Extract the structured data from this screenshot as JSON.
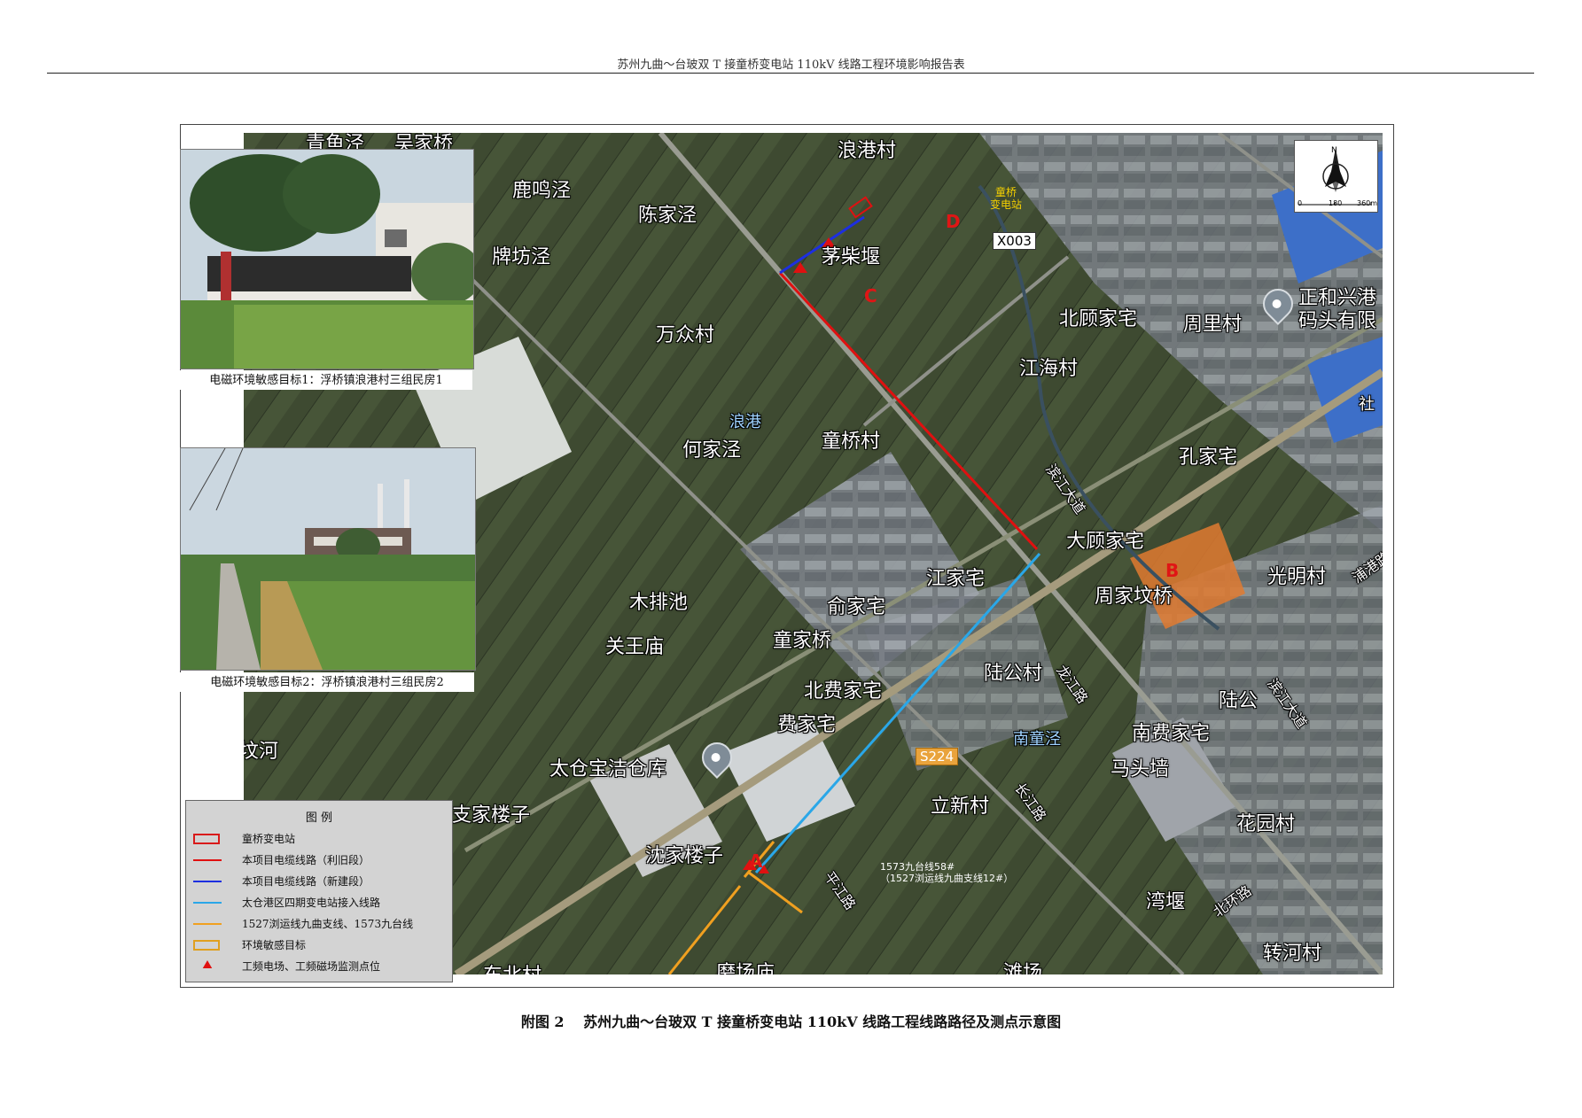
{
  "header": {
    "title": "苏州九曲～台玻双 T 接童桥变电站 110kV 线路工程环境影响报告表"
  },
  "map": {
    "places": {
      "qingyujing": "青鱼泾",
      "wujiaqiao": "吴家桥",
      "jiazhai": "家宅",
      "lumingjing": "鹿鸣泾",
      "langgangcun": "浪港村",
      "chenjiajing": "陈家泾",
      "paifangjing": "牌坊泾",
      "maochaiyan": "茅柴堰",
      "wanzhongcun": "万众村",
      "beigujiazhai": "北顾家宅",
      "zhoulicun": "周里村",
      "jianghaicun": "江海村",
      "langgang": "浪港",
      "hejiajing": "何家泾",
      "tongqiaocun": "童桥村",
      "kongjiazhai": "孔家宅",
      "dagujiazhai": "大顾家宅",
      "guangmingcun": "光明村",
      "zhoujiafenqiao": "周家坟桥",
      "jiangjiazhai": "江家宅",
      "mupaichi": "木排池",
      "yujiazhai": "俞家宅",
      "guanwangmiao": "关王庙",
      "tongjiaqiao": "童家桥",
      "lugongcun": "陆公村",
      "lugong": "陆公",
      "beifeijiazhai": "北费家宅",
      "feijiazhai": "费家宅",
      "nantongjing": "南童泾",
      "nanfeijiazhai": "南费家宅",
      "fenhe": "坟河",
      "taicangwarehouse": "太仓宝洁仓库",
      "matouqiang": "马头墙",
      "lixincun": "立新村",
      "zhijialouzi": "支家楼子",
      "huayuancun": "花园村",
      "shenjialouzi": "沈家楼子",
      "wanyan": "湾堰",
      "zhuanhecun": "转河村",
      "dongbeicun": "东北村",
      "mochangmiao": "磨场庙",
      "tanchang": "滩场",
      "zhenghexing": "正和兴港",
      "matouyouxian": "码头有限",
      "she": "社",
      "jiaqiao": "家桥"
    },
    "roads": {
      "binjiang1": "滨江大道",
      "binjiang2": "滨江大道",
      "pingjiang": "平江路",
      "longjiang": "龙江路",
      "changjiang": "长江路",
      "beihuan": "北环路",
      "pugang": "浦港路"
    },
    "tags": {
      "x003": "X003",
      "s224": "S224"
    },
    "points": {
      "A": "A",
      "B": "B",
      "C": "C",
      "D": "D"
    },
    "substation_label": [
      "童桥",
      "变电站"
    ],
    "pole_annotation": [
      "1573九台线58#",
      "（1527浏运线九曲支线12#）"
    ]
  },
  "compass": {
    "north": "N",
    "scale": [
      "0",
      "180",
      "360m"
    ]
  },
  "photos": [
    {
      "caption": "电磁环境敏感目标1：浮桥镇浪港村三组民房1"
    },
    {
      "caption": "电磁环境敏感目标2：浮桥镇浪港村三组民房2"
    }
  ],
  "legend": {
    "title": "图 例",
    "items": [
      {
        "label": "童桥变电站",
        "color": "#d91a1a",
        "kind": "rect"
      },
      {
        "label": "本项目电缆线路（利旧段）",
        "color": "#e01010",
        "kind": "line"
      },
      {
        "label": "本项目电缆线路（新建段）",
        "color": "#1d2fe0",
        "kind": "line"
      },
      {
        "label": "太仓港区四期变电站接入线路",
        "color": "#2aa7e8",
        "kind": "line"
      },
      {
        "label": "1527浏运线九曲支线、1573九台线",
        "color": "#f0a020",
        "kind": "line"
      },
      {
        "label": "环境敏感目标",
        "color": "#e0a020",
        "kind": "rect"
      },
      {
        "label": "工频电场、工频磁场监测点位",
        "color": "#e01010",
        "kind": "triangle"
      }
    ]
  },
  "figure_caption": "附图 2　 苏州九曲～台玻双 T 接童桥变电站 110kV 线路工程线路路径及测点示意图"
}
